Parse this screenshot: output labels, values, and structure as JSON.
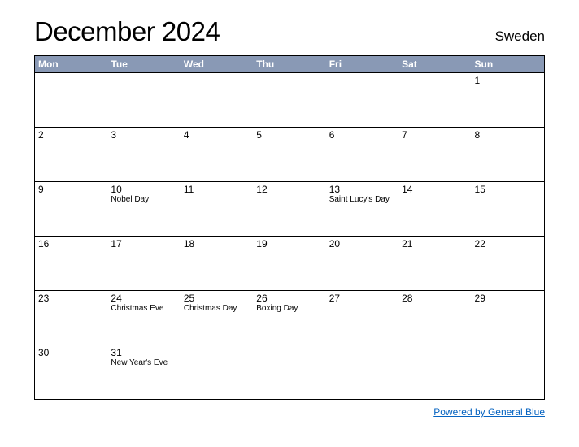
{
  "title": "December 2024",
  "region": "Sweden",
  "day_headers": [
    "Mon",
    "Tue",
    "Wed",
    "Thu",
    "Fri",
    "Sat",
    "Sun"
  ],
  "weeks": [
    [
      {
        "num": "",
        "event": ""
      },
      {
        "num": "",
        "event": ""
      },
      {
        "num": "",
        "event": ""
      },
      {
        "num": "",
        "event": ""
      },
      {
        "num": "",
        "event": ""
      },
      {
        "num": "",
        "event": ""
      },
      {
        "num": "1",
        "event": ""
      }
    ],
    [
      {
        "num": "2",
        "event": ""
      },
      {
        "num": "3",
        "event": ""
      },
      {
        "num": "4",
        "event": ""
      },
      {
        "num": "5",
        "event": ""
      },
      {
        "num": "6",
        "event": ""
      },
      {
        "num": "7",
        "event": ""
      },
      {
        "num": "8",
        "event": ""
      }
    ],
    [
      {
        "num": "9",
        "event": ""
      },
      {
        "num": "10",
        "event": "Nobel Day"
      },
      {
        "num": "11",
        "event": ""
      },
      {
        "num": "12",
        "event": ""
      },
      {
        "num": "13",
        "event": "Saint Lucy's Day"
      },
      {
        "num": "14",
        "event": ""
      },
      {
        "num": "15",
        "event": ""
      }
    ],
    [
      {
        "num": "16",
        "event": ""
      },
      {
        "num": "17",
        "event": ""
      },
      {
        "num": "18",
        "event": ""
      },
      {
        "num": "19",
        "event": ""
      },
      {
        "num": "20",
        "event": ""
      },
      {
        "num": "21",
        "event": ""
      },
      {
        "num": "22",
        "event": ""
      }
    ],
    [
      {
        "num": "23",
        "event": ""
      },
      {
        "num": "24",
        "event": "Christmas Eve"
      },
      {
        "num": "25",
        "event": "Christmas Day"
      },
      {
        "num": "26",
        "event": "Boxing Day"
      },
      {
        "num": "27",
        "event": ""
      },
      {
        "num": "28",
        "event": ""
      },
      {
        "num": "29",
        "event": ""
      }
    ],
    [
      {
        "num": "30",
        "event": ""
      },
      {
        "num": "31",
        "event": "New Year's Eve"
      },
      {
        "num": "",
        "event": ""
      },
      {
        "num": "",
        "event": ""
      },
      {
        "num": "",
        "event": ""
      },
      {
        "num": "",
        "event": ""
      },
      {
        "num": "",
        "event": ""
      }
    ]
  ],
  "footer_link": "Powered by General Blue"
}
